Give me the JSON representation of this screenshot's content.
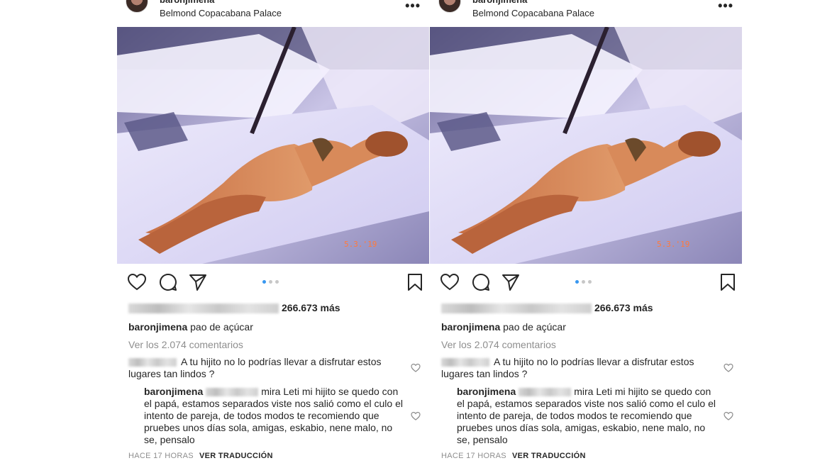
{
  "post": {
    "username": "baronjimena",
    "location": "Belmond Copacabana Palace",
    "photo_date_stamp": "5.3.'19",
    "likes_text": "266.673 más",
    "caption_user": "baronjimena",
    "caption_text": "pao de açúcar",
    "view_comments": "Ver los 2.074 comentarios",
    "comment1_text": "A  tu hijito no lo podrías llevar a disfrutar estos lugares tan lindos ?",
    "reply_user": "baronjimena",
    "reply_text": "mira Leti mi hijito se quedo con el papá, estamos separados viste nos salió como el culo el intento de pareja, de todos modos te recomiendo que pruebes unos días sola, amigas, eskabio, nene malo, no se, pensalo",
    "timestamp": "HACE 17 HORAS",
    "translate": "VER TRADUCCIÓN",
    "carousel": {
      "total": 3,
      "active": 1
    }
  },
  "icons": {
    "like": "heart-icon",
    "comment": "comment-icon",
    "share": "share-icon",
    "save": "bookmark-icon",
    "more": "more-icon"
  },
  "colors": {
    "text": "#262626",
    "muted": "#8e8e8e",
    "active_dot": "#3897f0"
  }
}
